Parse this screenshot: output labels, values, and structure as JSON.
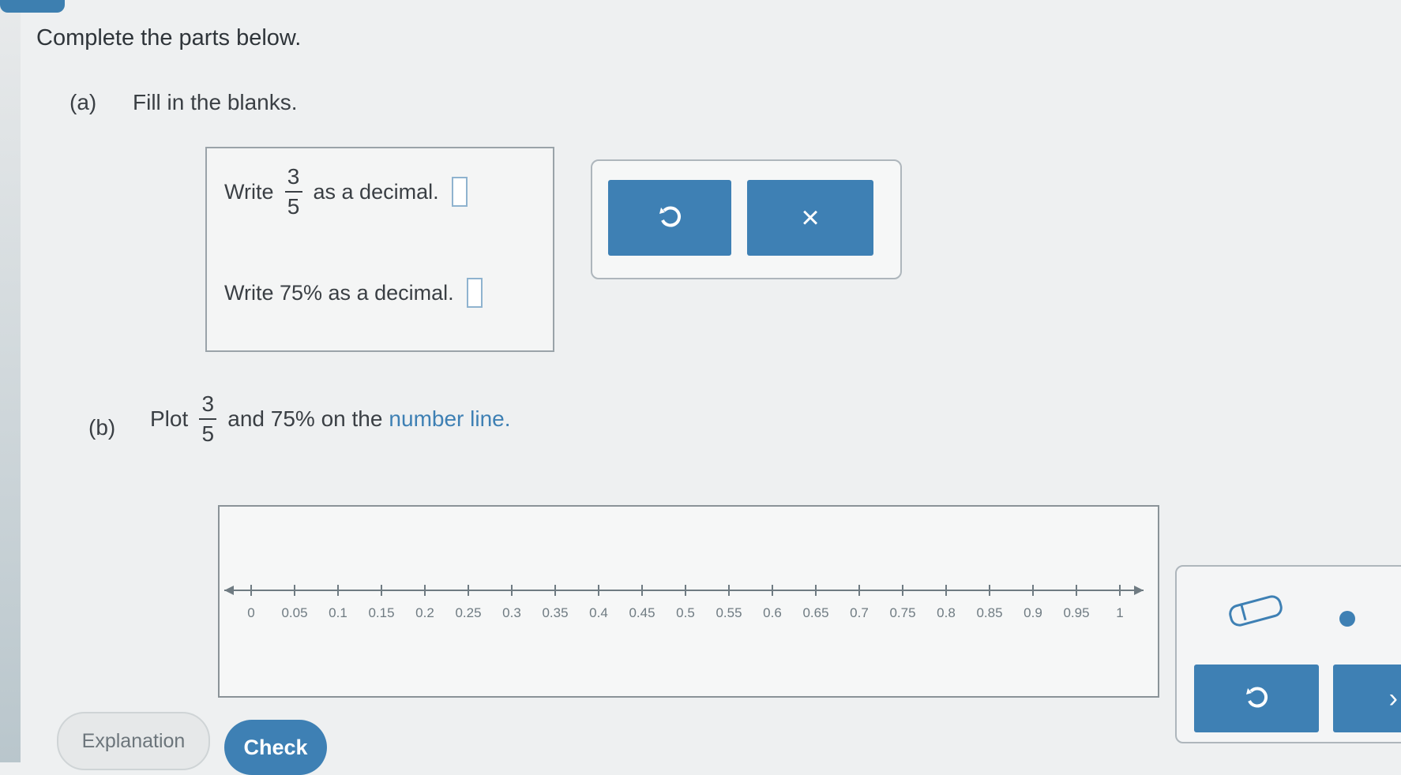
{
  "instruction": "Complete the parts below.",
  "part_a": {
    "label": "(a)",
    "text": "Fill in the blanks.",
    "q1": {
      "prefix": "Write",
      "numerator": "3",
      "denominator": "5",
      "suffix": "as a decimal.",
      "answer": ""
    },
    "q2": {
      "text": "Write 75% as a decimal.",
      "answer": ""
    },
    "tools": {
      "undo_icon": "undo-icon",
      "clear_label": "×"
    }
  },
  "part_b": {
    "label": "(b)",
    "prefix": "Plot",
    "numerator": "3",
    "denominator": "5",
    "suffix_plain": "and 75% on the",
    "suffix_link": "number line.",
    "number_line": {
      "min": 0,
      "max": 1,
      "step": 0.05,
      "ticks": [
        "0",
        "0.05",
        "0.1",
        "0.15",
        "0.2",
        "0.25",
        "0.3",
        "0.35",
        "0.4",
        "0.45",
        "0.5",
        "0.55",
        "0.6",
        "0.65",
        "0.7",
        "0.75",
        "0.8",
        "0.85",
        "0.9",
        "0.95",
        "1"
      ],
      "plotted_points": []
    },
    "tools": {
      "pencil_icon": "pencil-icon",
      "point_icon": "point-icon",
      "undo_icon": "undo-icon",
      "next_label": "›"
    }
  },
  "footer": {
    "explanation_label": "Explanation",
    "check_label": "Check"
  },
  "colors": {
    "accent": "#3e80b4",
    "link": "#3e80b4"
  }
}
